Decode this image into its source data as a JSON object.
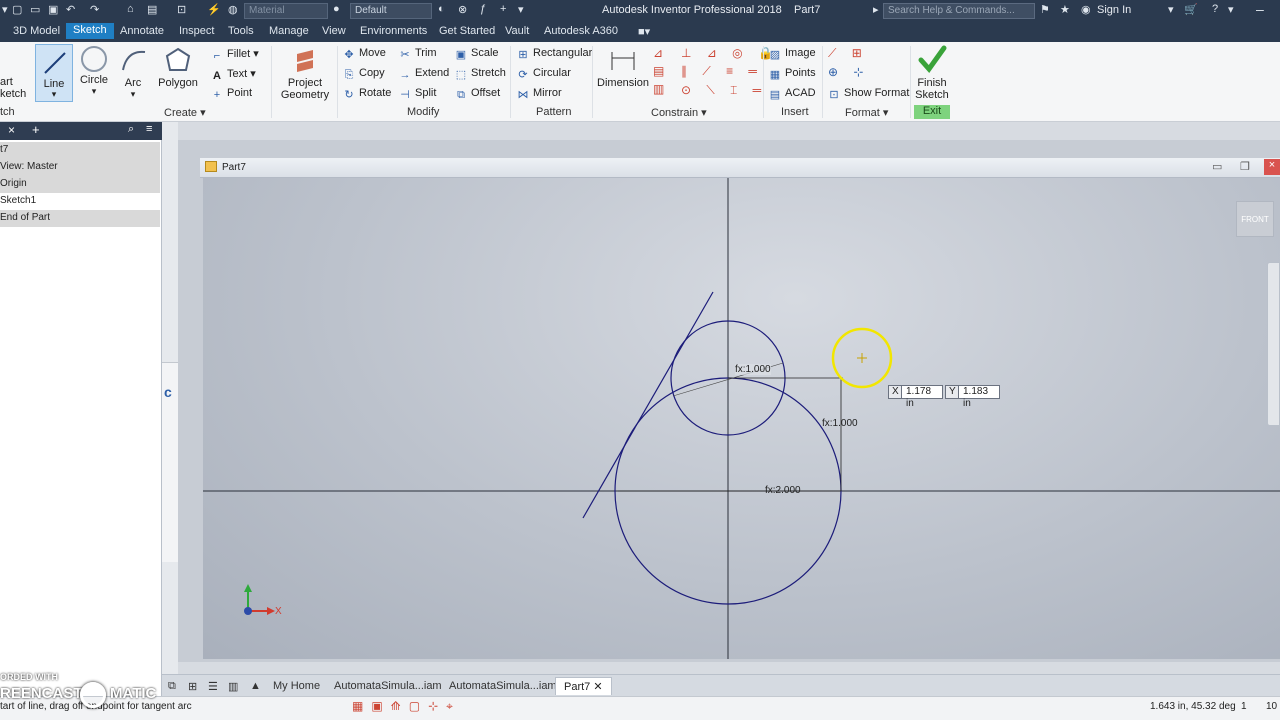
{
  "titlebar": {
    "material_placeholder": "Material",
    "appearance": "Default",
    "app_title": "Autodesk Inventor Professional 2018",
    "doc_title": "Part7",
    "search_placeholder": "Search Help & Commands...",
    "signin": "Sign In"
  },
  "tabs": [
    "3D Model",
    "Sketch",
    "Annotate",
    "Inspect",
    "Tools",
    "Manage",
    "View",
    "Environments",
    "Get Started",
    "Vault",
    "Autodesk A360"
  ],
  "ribbon": {
    "create": {
      "start_sketch_1": "art",
      "start_sketch_2": "ketch",
      "line": "Line",
      "circle": "Circle",
      "arc": "Arc",
      "polygon": "Polygon",
      "fillet": "Fillet",
      "text": "Text",
      "point": "Point",
      "label": "Create",
      "left_label": "tch",
      "project_geometry_1": "Project",
      "project_geometry_2": "Geometry"
    },
    "modify": {
      "move": "Move",
      "copy": "Copy",
      "rotate": "Rotate",
      "trim": "Trim",
      "extend": "Extend",
      "split": "Split",
      "scale": "Scale",
      "stretch": "Stretch",
      "offset": "Offset",
      "label": "Modify"
    },
    "pattern": {
      "rectangular": "Rectangular",
      "circular": "Circular",
      "mirror": "Mirror",
      "label": "Pattern"
    },
    "constrain": {
      "dimension": "Dimension",
      "label": "Constrain"
    },
    "insert": {
      "image": "Image",
      "points": "Points",
      "acad": "ACAD",
      "label": "Insert"
    },
    "format": {
      "show_format": "Show Format",
      "label": "Format"
    },
    "exit": {
      "finish_1": "Finish",
      "finish_2": "Sketch",
      "label": "Exit"
    }
  },
  "browser": {
    "rows": [
      "t7",
      "View: Master",
      "Origin",
      "Sketch1",
      "End of Part"
    ]
  },
  "canvas": {
    "view_cube_label": "FRONT",
    "window_title": "Part7",
    "dim_small_circle": "fx:1.000",
    "dim_vertical": "fx:1.000",
    "dim_horizontal": "fx:2.000",
    "coord_x_label": "X",
    "coord_x_value": "1.178 in",
    "coord_y_label": "Y",
    "coord_y_value": "1.183 in",
    "axis_x": "X"
  },
  "doc_tabs": [
    "My Home",
    "AutomataSimula...iam",
    "AutomataSimula...iam",
    "Part7"
  ],
  "status": {
    "message": "tart of line, drag off endpoint for tangent arc",
    "coords": "1.643 in, 45.32 deg",
    "count_1": "1",
    "count_2": "10"
  },
  "watermark": {
    "line1": "ORDED WITH",
    "line2": "REENCAST",
    "line3": "MATIC"
  }
}
